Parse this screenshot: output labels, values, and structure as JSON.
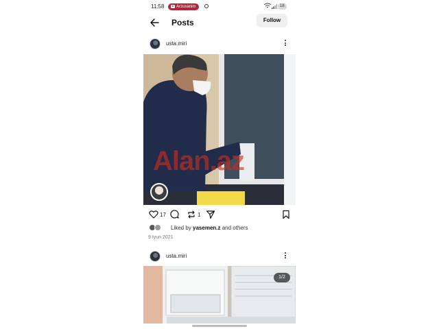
{
  "status_bar": {
    "time": "11:58",
    "notification_pill": "Arzuxanim",
    "battery": "18"
  },
  "header": {
    "title": "Posts",
    "follow_label": "Follow"
  },
  "posts": [
    {
      "username": "usta.miri",
      "watermark": "Alan.az",
      "likes_count": "17",
      "reposts_count": "1",
      "liked_by_prefix": "Liked by ",
      "liked_by_user": "yasemen.z",
      "liked_by_suffix": " and others",
      "date": "9 Iyun 2021"
    },
    {
      "username": "usta.miri",
      "media_counter": "1/2"
    }
  ],
  "colors": {
    "status_pill": "#b0263c",
    "follow_button_bg": "#efefef",
    "watermark": "#cd2d1e"
  }
}
